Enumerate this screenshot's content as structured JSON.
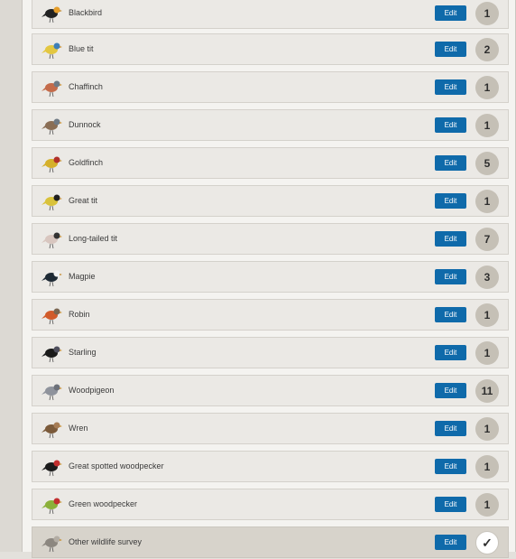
{
  "birds": [
    {
      "name": "Blackbird",
      "count": "1",
      "edit": "Edit",
      "icon": "blackbird-icon",
      "colors": [
        "#222222",
        "#e59d2a"
      ]
    },
    {
      "name": "Blue tit",
      "count": "2",
      "edit": "Edit",
      "icon": "blue-tit-icon",
      "colors": [
        "#e3c741",
        "#3e7fb8"
      ]
    },
    {
      "name": "Chaffinch",
      "count": "1",
      "edit": "Edit",
      "icon": "chaffinch-icon",
      "colors": [
        "#c46b4a",
        "#6f7b86"
      ]
    },
    {
      "name": "Dunnock",
      "count": "1",
      "edit": "Edit",
      "icon": "dunnock-icon",
      "colors": [
        "#8a6e55",
        "#707a84"
      ]
    },
    {
      "name": "Goldfinch",
      "count": "5",
      "edit": "Edit",
      "icon": "goldfinch-icon",
      "colors": [
        "#d5b02a",
        "#b0302a"
      ]
    },
    {
      "name": "Great tit",
      "count": "1",
      "edit": "Edit",
      "icon": "great-tit-icon",
      "colors": [
        "#d9c23b",
        "#1f1f1f"
      ]
    },
    {
      "name": "Long-tailed tit",
      "count": "7",
      "edit": "Edit",
      "icon": "long-tailed-tit-icon",
      "colors": [
        "#d8c6bf",
        "#333333"
      ]
    },
    {
      "name": "Magpie",
      "count": "3",
      "edit": "Edit",
      "icon": "magpie-icon",
      "colors": [
        "#1e2a35",
        "#f2f2f2"
      ]
    },
    {
      "name": "Robin",
      "count": "1",
      "edit": "Edit",
      "icon": "robin-icon",
      "colors": [
        "#d15b2a",
        "#7a6650"
      ]
    },
    {
      "name": "Starling",
      "count": "1",
      "edit": "Edit",
      "icon": "starling-icon",
      "colors": [
        "#1a1a1a",
        "#4e4e5c"
      ]
    },
    {
      "name": "Woodpigeon",
      "count": "11",
      "edit": "Edit",
      "icon": "woodpigeon-icon",
      "colors": [
        "#8f939c",
        "#6c7079"
      ]
    },
    {
      "name": "Wren",
      "count": "1",
      "edit": "Edit",
      "icon": "wren-icon",
      "colors": [
        "#7b5a3a",
        "#a67c55"
      ]
    },
    {
      "name": "Great spotted woodpecker",
      "count": "1",
      "edit": "Edit",
      "icon": "great-spotted-woodpecker-icon",
      "colors": [
        "#1b1b1b",
        "#c22f2f"
      ]
    },
    {
      "name": "Green woodpecker",
      "count": "1",
      "edit": "Edit",
      "icon": "green-woodpecker-icon",
      "colors": [
        "#8bb03a",
        "#c22f2f"
      ]
    },
    {
      "name": "Other wildlife survey",
      "count": "✓",
      "edit": "Edit",
      "icon": "squirrel-icon",
      "colors": [
        "#8c8780",
        "#b3ada4"
      ]
    }
  ],
  "accent": "#0f6aaa",
  "badge_color": "#c5c0b6"
}
